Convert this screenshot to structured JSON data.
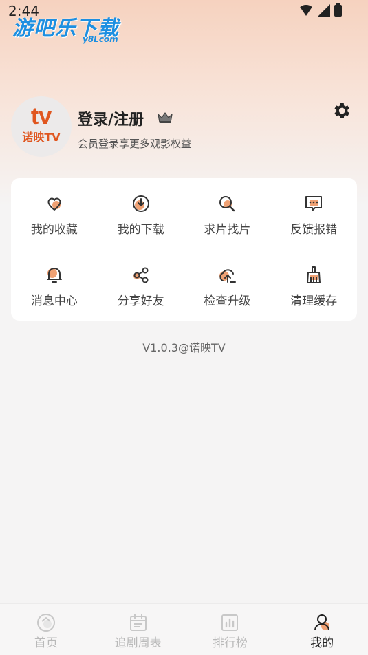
{
  "status_bar": {
    "time": "2:44"
  },
  "watermark": {
    "text": "游吧乐下载",
    "sub": "y8Lcom"
  },
  "profile": {
    "avatar_logo": "tv",
    "avatar_text": "诺映TV",
    "login_title": "登录/注册",
    "subtitle": "会员登录享更多观影权益"
  },
  "menu": {
    "items": [
      {
        "label": "我的收藏",
        "icon": "heart-icon"
      },
      {
        "label": "我的下载",
        "icon": "download-icon"
      },
      {
        "label": "求片找片",
        "icon": "search-film-icon"
      },
      {
        "label": "反馈报错",
        "icon": "feedback-icon"
      },
      {
        "label": "消息中心",
        "icon": "bell-icon"
      },
      {
        "label": "分享好友",
        "icon": "share-icon"
      },
      {
        "label": "检查升级",
        "icon": "cloud-upload-icon"
      },
      {
        "label": "清理缓存",
        "icon": "broom-icon"
      }
    ]
  },
  "version": "V1.0.3@诺映TV",
  "tabbar": {
    "tabs": [
      {
        "label": "首页",
        "icon": "home-icon",
        "active": false
      },
      {
        "label": "追剧周表",
        "icon": "calendar-icon",
        "active": false
      },
      {
        "label": "排行榜",
        "icon": "chart-icon",
        "active": false
      },
      {
        "label": "我的",
        "icon": "profile-icon",
        "active": true
      }
    ]
  },
  "colors": {
    "accent": "#f0a173",
    "brand": "#e0561f",
    "text": "#222222"
  }
}
